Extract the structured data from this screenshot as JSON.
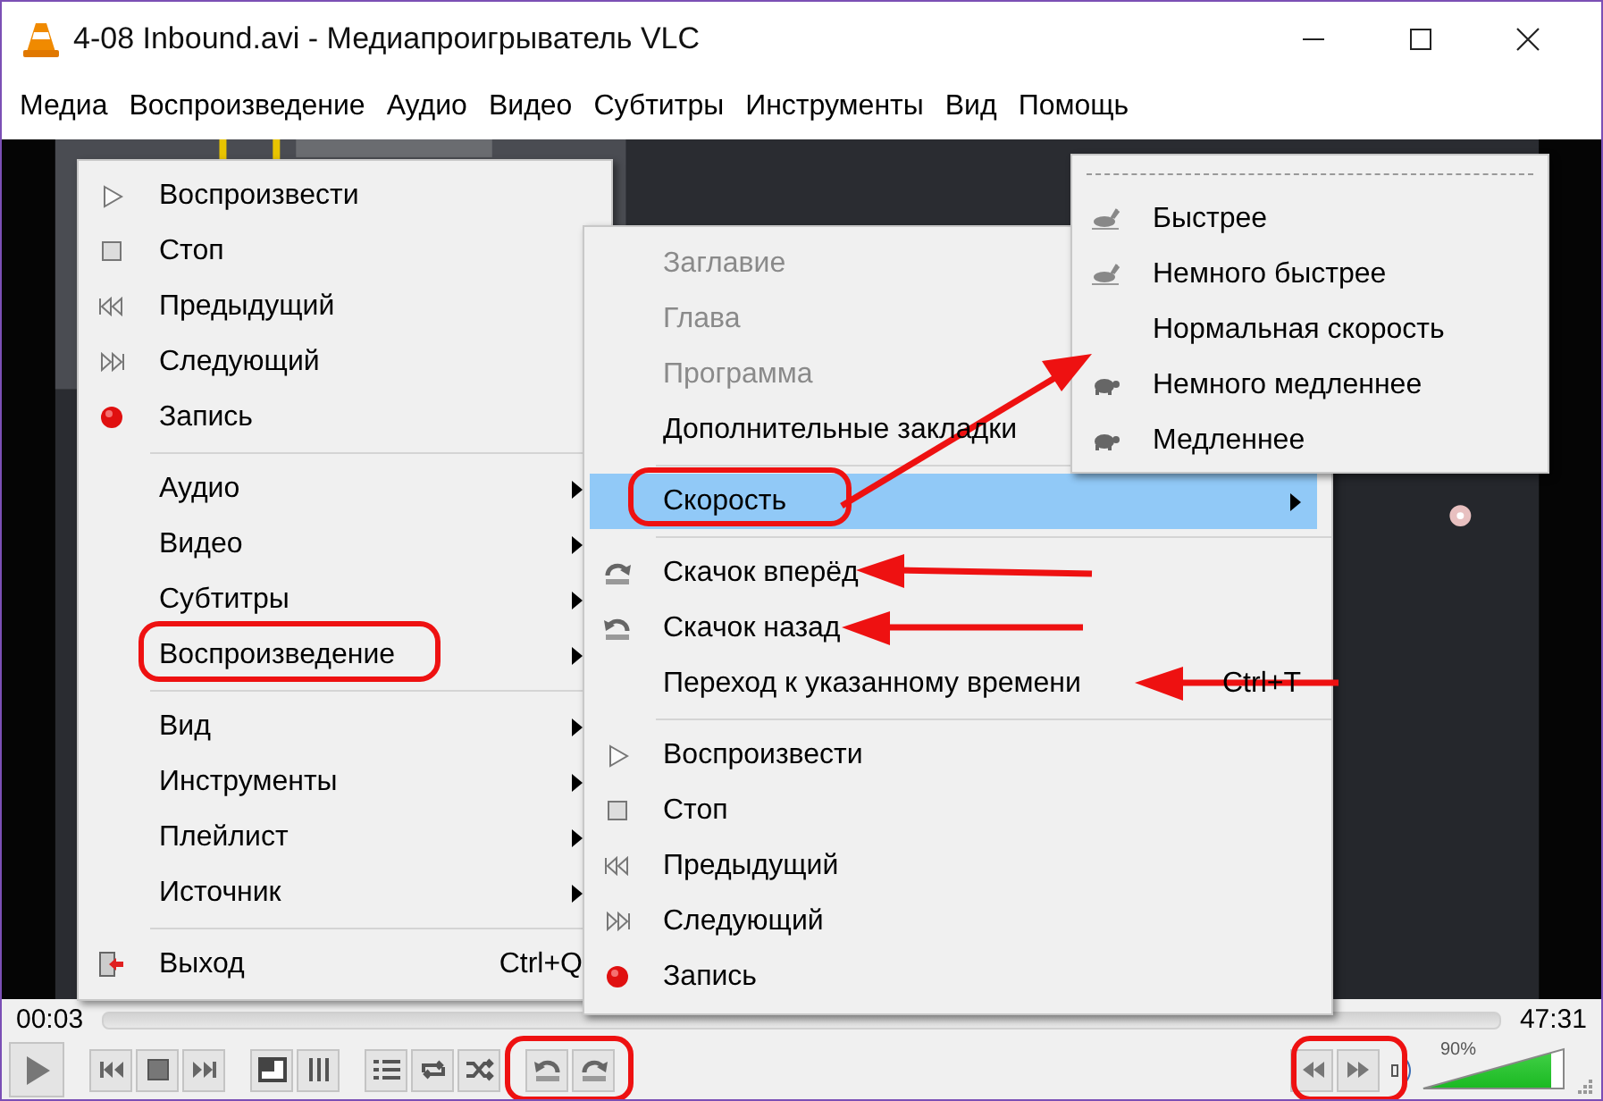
{
  "window": {
    "title": "4-08 Inbound.avi - Медиапроигрыватель VLC"
  },
  "menu_bar": [
    "Медиа",
    "Воспроизведение",
    "Аудио",
    "Видео",
    "Субтитры",
    "Инструменты",
    "Вид",
    "Помощь"
  ],
  "menus": [
    {
      "items": [
        {
          "kind": "play",
          "label": "Воспроизвести",
          "submenu": false
        },
        {
          "kind": "stop",
          "label": "Стоп",
          "submenu": false
        },
        {
          "kind": "previous",
          "label": "Предыдущий",
          "submenu": false
        },
        {
          "kind": "next",
          "label": "Следующий",
          "submenu": false
        },
        {
          "kind": "record",
          "label": "Запись",
          "submenu": false
        },
        {
          "kind": "separator"
        },
        {
          "kind": "plain",
          "label": "Аудио",
          "submenu": true
        },
        {
          "kind": "plain",
          "label": "Видео",
          "submenu": true
        },
        {
          "kind": "plain",
          "label": "Субтитры",
          "submenu": true
        },
        {
          "kind": "plain",
          "label": "Воспроизведение",
          "submenu": true
        },
        {
          "kind": "separator"
        },
        {
          "kind": "plain",
          "label": "Вид",
          "submenu": true
        },
        {
          "kind": "plain",
          "label": "Инструменты",
          "submenu": true
        },
        {
          "kind": "plain",
          "label": "Плейлист",
          "submenu": true
        },
        {
          "kind": "plain",
          "label": "Источник",
          "submenu": true
        },
        {
          "kind": "separator"
        },
        {
          "kind": "exit",
          "label": "Выход",
          "shortcut": "Ctrl+Q",
          "submenu": false
        }
      ]
    },
    {
      "items": [
        {
          "kind": "plain",
          "label": "Заглавие",
          "disabled": true,
          "selected": false,
          "submenu": false
        },
        {
          "kind": "plain",
          "label": "Глава",
          "disabled": true,
          "selected": false,
          "submenu": false
        },
        {
          "kind": "plain",
          "label": "Программа",
          "disabled": true,
          "selected": false,
          "submenu": false
        },
        {
          "kind": "plain",
          "label": "Дополнительные закладки",
          "disabled": false,
          "selected": false,
          "submenu": false
        },
        {
          "kind": "separator"
        },
        {
          "kind": "plain",
          "label": "Скорость",
          "disabled": false,
          "selected": true,
          "submenu": true
        },
        {
          "kind": "separator"
        },
        {
          "kind": "jump-forward",
          "label": "Скачок вперёд",
          "disabled": false,
          "selected": false,
          "submenu": false
        },
        {
          "kind": "jump-backward",
          "label": "Скачок назад",
          "disabled": false,
          "selected": false,
          "submenu": false
        },
        {
          "kind": "plain",
          "label": "Переход к указанному времени",
          "shortcut": "Ctrl+T",
          "disabled": false,
          "selected": false,
          "submenu": false
        },
        {
          "kind": "separator"
        },
        {
          "kind": "play",
          "label": "Воспроизвести",
          "disabled": false,
          "selected": false,
          "submenu": false
        },
        {
          "kind": "stop",
          "label": "Стоп",
          "disabled": false,
          "selected": false,
          "submenu": false
        },
        {
          "kind": "previous",
          "label": "Предыдущий",
          "disabled": false,
          "selected": false,
          "submenu": false
        },
        {
          "kind": "next",
          "label": "Следующий",
          "disabled": false,
          "selected": false,
          "submenu": false
        },
        {
          "kind": "record",
          "label": "Запись",
          "disabled": false,
          "selected": false,
          "submenu": false
        }
      ]
    },
    {
      "tear_off": true,
      "items": [
        {
          "kind": "faster",
          "label": "Быстрее"
        },
        {
          "kind": "faster",
          "label": "Немного быстрее"
        },
        {
          "kind": "plain",
          "label": "Нормальная скорость"
        },
        {
          "kind": "slower",
          "label": "Немного медленнее"
        },
        {
          "kind": "slower",
          "label": "Медленнее"
        }
      ]
    }
  ],
  "controls": {
    "elapsed": "00:03",
    "total": "47:31",
    "volume": {
      "reading": "90%",
      "level": 0.9
    }
  }
}
